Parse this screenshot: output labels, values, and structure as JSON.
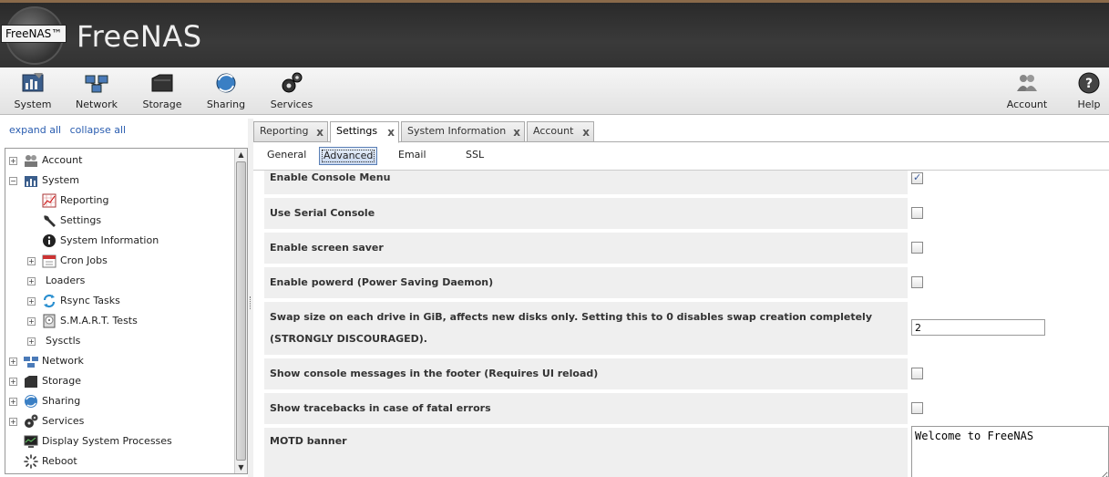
{
  "header": {
    "brand": "FreeNAS",
    "badge": "FreeNAS™"
  },
  "toolbar": {
    "left": [
      {
        "id": "system",
        "label": "System",
        "icon": "system-icon"
      },
      {
        "id": "network",
        "label": "Network",
        "icon": "network-icon"
      },
      {
        "id": "storage",
        "label": "Storage",
        "icon": "storage-icon"
      },
      {
        "id": "sharing",
        "label": "Sharing",
        "icon": "sharing-icon"
      },
      {
        "id": "services",
        "label": "Services",
        "icon": "services-icon"
      }
    ],
    "right": [
      {
        "id": "account",
        "label": "Account",
        "icon": "account-icon"
      },
      {
        "id": "help",
        "label": "Help",
        "icon": "help-icon"
      }
    ]
  },
  "sidebar": {
    "expand_all": "expand all",
    "collapse_all": "collapse all",
    "tree": [
      {
        "label": "Account",
        "toggle": "+"
      },
      {
        "label": "System",
        "toggle": "−"
      },
      {
        "label": "Reporting"
      },
      {
        "label": "Settings"
      },
      {
        "label": "System Information"
      },
      {
        "label": "Cron Jobs",
        "toggle": "+"
      },
      {
        "label": "Loaders",
        "toggle": "+"
      },
      {
        "label": "Rsync Tasks",
        "toggle": "+"
      },
      {
        "label": "S.M.A.R.T. Tests",
        "toggle": "+"
      },
      {
        "label": "Sysctls",
        "toggle": "+"
      },
      {
        "label": "Network",
        "toggle": "+"
      },
      {
        "label": "Storage",
        "toggle": "+"
      },
      {
        "label": "Sharing",
        "toggle": "+"
      },
      {
        "label": "Services",
        "toggle": "+"
      },
      {
        "label": "Display System Processes"
      },
      {
        "label": "Reboot"
      }
    ]
  },
  "tabs": [
    {
      "label": "Reporting"
    },
    {
      "label": "Settings",
      "active": true
    },
    {
      "label": "System Information"
    },
    {
      "label": "Account"
    }
  ],
  "tab_close": "x",
  "subtabs": [
    {
      "label": "General"
    },
    {
      "label": "Advanced",
      "active": true
    },
    {
      "label": "Email"
    },
    {
      "label": "SSL"
    }
  ],
  "form": {
    "rows": [
      {
        "label": "Enable Console Menu",
        "type": "checkbox",
        "checked": true
      },
      {
        "label": "Use Serial Console",
        "type": "checkbox",
        "checked": false
      },
      {
        "label": "Enable screen saver",
        "type": "checkbox",
        "checked": false
      },
      {
        "label": "Enable powerd (Power Saving Daemon)",
        "type": "checkbox",
        "checked": false
      },
      {
        "label": "Swap size on each drive in GiB, affects new disks only. Setting this to 0 disables swap creation completely (STRONGLY DISCOURAGED).",
        "type": "text",
        "value": "2"
      },
      {
        "label": "Show console messages in the footer (Requires UI reload)",
        "type": "checkbox",
        "checked": false
      },
      {
        "label": "Show tracebacks in case of fatal errors",
        "type": "checkbox",
        "checked": false
      },
      {
        "label": "MOTD banner",
        "type": "textarea",
        "value": "Welcome to FreeNAS"
      }
    ]
  }
}
